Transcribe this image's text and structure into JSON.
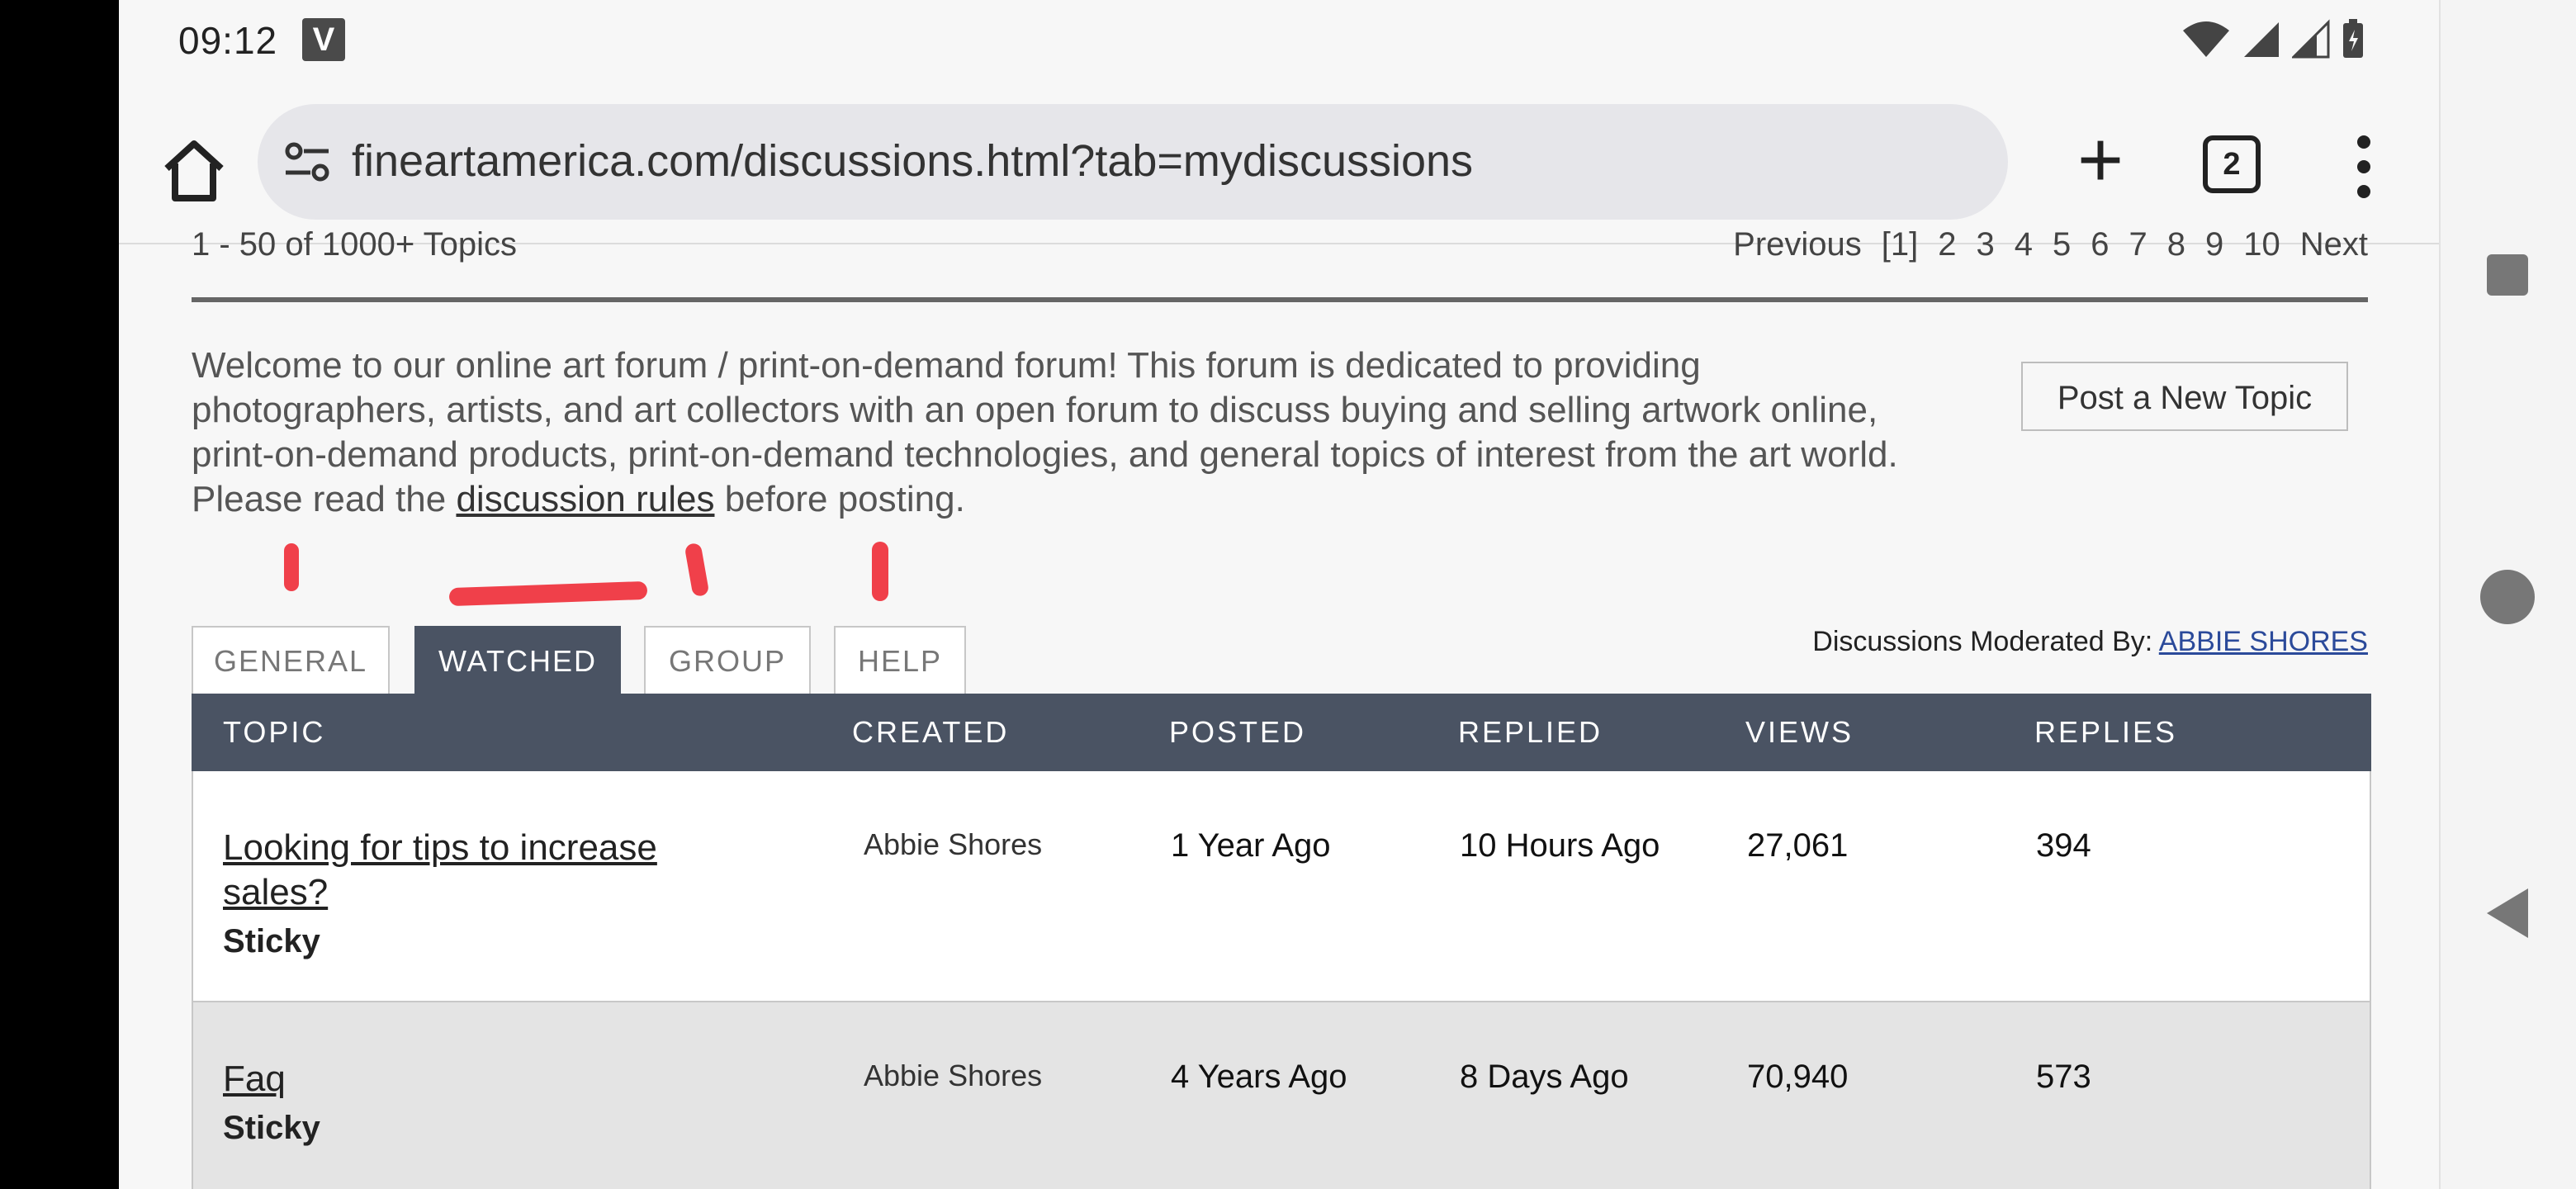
{
  "status_bar": {
    "time": "09:12",
    "app_icon_letter": "V"
  },
  "browser": {
    "url": "fineartamerica.com/discussions.html?tab=mydiscussions",
    "tab_count": "2"
  },
  "pager": {
    "summary": "1 - 50 of 1000+ Topics",
    "previous": "Previous",
    "pages": [
      "[1]",
      "2",
      "3",
      "4",
      "5",
      "6",
      "7",
      "8",
      "9",
      "10"
    ],
    "next": "Next"
  },
  "intro": {
    "text_before_link": "Welcome to our online art forum / print-on-demand forum!  This forum is dedicated to providing photographers, artists, and art collectors with an open forum to discuss buying and selling artwork online, print-on-demand products, print-on-demand technologies, and general topics of interest from the art world.   Please read the ",
    "link_text": "discussion rules",
    "text_after_link": " before posting."
  },
  "post_button": "Post a New Topic",
  "tabs": [
    {
      "label": "GENERAL",
      "active": false
    },
    {
      "label": "WATCHED",
      "active": true
    },
    {
      "label": "GROUP",
      "active": false
    },
    {
      "label": "HELP",
      "active": false
    }
  ],
  "moderator": {
    "label": "Discussions Moderated By: ",
    "name": "ABBIE SHORES"
  },
  "table": {
    "headers": [
      "TOPIC",
      "CREATED",
      "POSTED",
      "REPLIED",
      "VIEWS",
      "REPLIES"
    ],
    "rows": [
      {
        "topic": "Looking for tips to increase sales? ",
        "tag": "Sticky",
        "created": "Abbie Shores",
        "posted": "1 Year Ago",
        "replied": "10 Hours Ago",
        "views": "27,061",
        "replies": "394"
      },
      {
        "topic": "Faq ",
        "tag": "Sticky",
        "created": "Abbie Shores",
        "posted": "4 Years Ago",
        "replied": "8 Days Ago",
        "views": "70,940",
        "replies": "573"
      }
    ]
  },
  "colors": {
    "header_bg": "#4a5363",
    "annotation_red": "#f0404a",
    "link_blue": "#2b4a9a"
  }
}
